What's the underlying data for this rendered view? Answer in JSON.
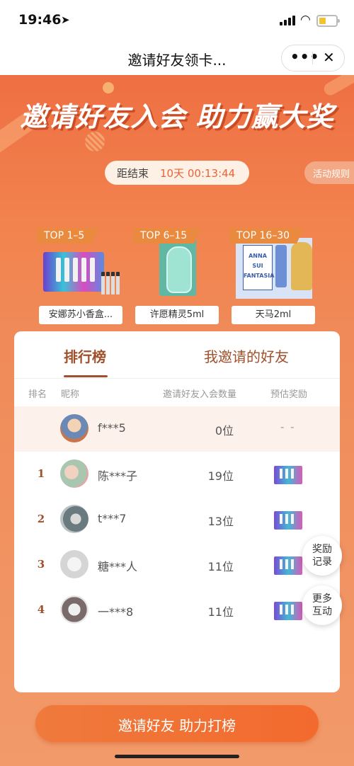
{
  "status_bar": {
    "time": "19:46",
    "location_glyph": "➤"
  },
  "nav": {
    "title": "邀请好友领卡...",
    "more_label": "•••",
    "close_label": "✕"
  },
  "banner": {
    "headline": "邀请好友入会 助力赢大奖",
    "countdown_label": "距结束",
    "countdown_value": "10天 00:13:44",
    "rules_label": "活动规则"
  },
  "prizes": [
    {
      "tag": "TOP 1–5",
      "name": "安娜苏小香盒..."
    },
    {
      "tag": "TOP 6–15",
      "name": "许愿精灵5ml"
    },
    {
      "tag": "TOP 16–30",
      "name": "天马2ml"
    }
  ],
  "box3_text": "ANNA SUI FANTASIA",
  "tabs": {
    "leaderboard": "排行榜",
    "my_invites": "我邀请的好友"
  },
  "columns": {
    "rank": "排名",
    "nickname": "昵称",
    "count": "邀请好友入会数量",
    "reward": "预估奖励"
  },
  "me": {
    "nickname": "f***5",
    "count": "0位",
    "reward": "- -"
  },
  "rows": [
    {
      "rank": "1",
      "nickname": "陈***子",
      "count": "19位"
    },
    {
      "rank": "2",
      "nickname": "t***7",
      "count": "13位"
    },
    {
      "rank": "3",
      "nickname": "糖***人",
      "count": "11位"
    },
    {
      "rank": "4",
      "nickname": "一***8",
      "count": "11位"
    }
  ],
  "floating": {
    "rewards_line1": "奖励",
    "rewards_line2": "记录",
    "more_line1": "更多",
    "more_line2": "互动"
  },
  "cta_label": "邀请好友 助力打榜",
  "colors": {
    "accent": "#ee7d4a",
    "brown": "#a0502b",
    "cta": "#f36a2e"
  }
}
